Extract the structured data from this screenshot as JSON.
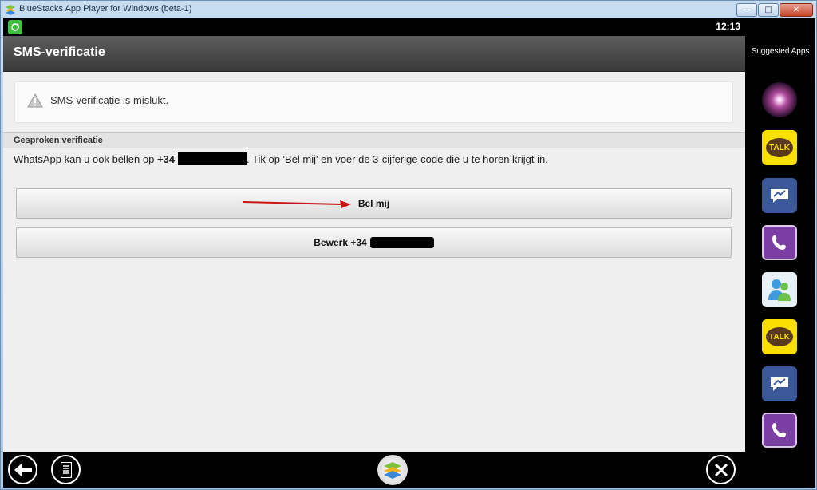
{
  "window": {
    "title": "BlueStacks App Player for Windows (beta-1)",
    "min": "–",
    "max": "□",
    "close": "✕"
  },
  "status": {
    "time": "12:13"
  },
  "screen": {
    "title": "SMS-verificatie",
    "notice": "SMS-verificatie is mislukt.",
    "section_header": "Gesproken verificatie",
    "desc_prefix": "WhatsApp kan u ook bellen op ",
    "phone_prefix": "+34",
    "desc_suffix": ". Tik op 'Bel mij' en voer de 3-cijferige code die u te horen krijgt in.",
    "call_button": "Bel mij",
    "edit_button": "Bewerk +34"
  },
  "sidebar": {
    "title": "Suggested Apps",
    "apps": [
      "galaxy-app-icon",
      "kakaotalk-icon",
      "messenger-icon",
      "viber-icon",
      "windows-live-messenger-icon",
      "kakaotalk-icon",
      "messenger-icon",
      "viber-icon"
    ],
    "talk_label": "TALK"
  },
  "colors": {
    "accent_arrow": "#c81414",
    "statusbar": "#000000",
    "actionbar": "#4a4a4a"
  }
}
